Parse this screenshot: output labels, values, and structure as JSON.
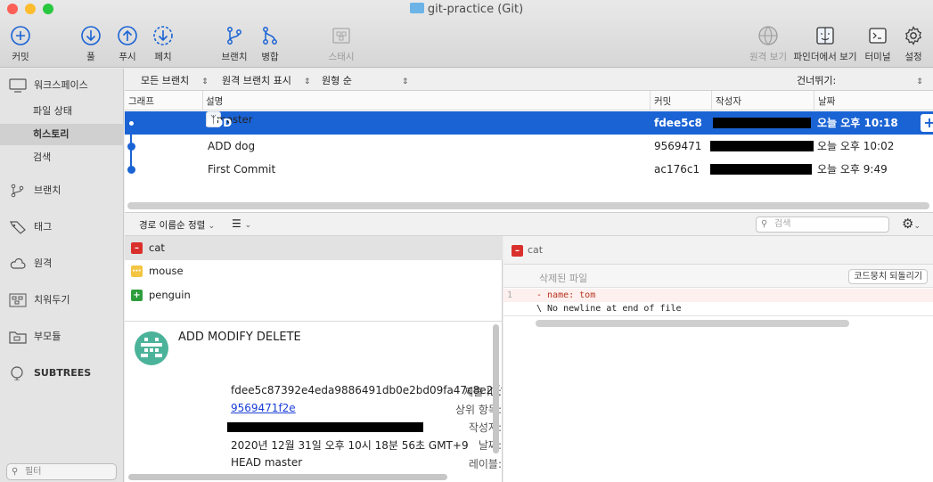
{
  "window": {
    "title": "git-practice (Git)"
  },
  "toolbar": {
    "commit": "커밋",
    "pull": "풀",
    "push": "푸시",
    "fetch": "페치",
    "branch": "브랜치",
    "merge": "병합",
    "stash": "스태시",
    "remote_view": "원격 보기",
    "finder": "파인더에서 보기",
    "terminal": "터미널",
    "settings": "설정"
  },
  "sidebar": {
    "workspace": "워크스페이스",
    "file_status": "파일 상태",
    "history": "히스토리",
    "search": "검색",
    "branches": "브랜치",
    "tags": "태그",
    "remotes": "원격",
    "stashes": "치워두기",
    "submodules": "부모듈",
    "subtrees": "SUBTREES",
    "filter_placeholder": "필터"
  },
  "filterbar": {
    "branches": "모든 브랜치",
    "remote": "원격 브랜치 표시",
    "order": "원형 순",
    "jump": "건너뛰기:"
  },
  "history": {
    "columns": [
      "그래프",
      "설명",
      "커밋",
      "작성자",
      "날짜"
    ],
    "rows": [
      {
        "tag": "master",
        "desc": "ADD MODIFY DELETE",
        "hash": "fdee5c8",
        "date": "오늘 오후 10:18"
      },
      {
        "tag": "",
        "desc": "ADD dog",
        "hash": "9569471",
        "date": "오늘 오후 10:02"
      },
      {
        "tag": "",
        "desc": "First Commit",
        "hash": "ac176c1",
        "date": "오늘 오후 9:49"
      }
    ]
  },
  "lowerbar": {
    "sort": "경로 이름순 정렬",
    "search_placeholder": "검색"
  },
  "files": [
    {
      "name": "cat",
      "status": "deleted",
      "color": "#d9302c"
    },
    {
      "name": "mouse",
      "status": "modified",
      "color": "#f3c543"
    },
    {
      "name": "penguin",
      "status": "added",
      "color": "#2e9d3c"
    }
  ],
  "details": {
    "title": "ADD MODIFY DELETE",
    "labels": {
      "sha": "제출 ID:",
      "parent": "상위 항목:",
      "author": "작성자:",
      "date": "날짜:",
      "refs": "레이블:"
    },
    "sha": "fdee5c87392e4eda9886491db0e2bd09fa47c8e2 [f",
    "parent": "9569471f2e",
    "date": "2020년 12월 31일 오후 10시 18분 56초 GMT+9",
    "refs": "HEAD master"
  },
  "diff": {
    "file": "cat",
    "hunk_label": "삭제된 파일",
    "revert": "코드뭉치 되돌리기",
    "lines": [
      {
        "no": "1",
        "text": "- name: tom",
        "kind": "del"
      },
      {
        "no": "",
        "text": "\\  No newline at end of file",
        "kind": "meta"
      }
    ]
  },
  "colors": {
    "accent": "#1a63d4",
    "deleted": "#d9302c",
    "added": "#2e9d3c",
    "modified": "#f3c543"
  }
}
